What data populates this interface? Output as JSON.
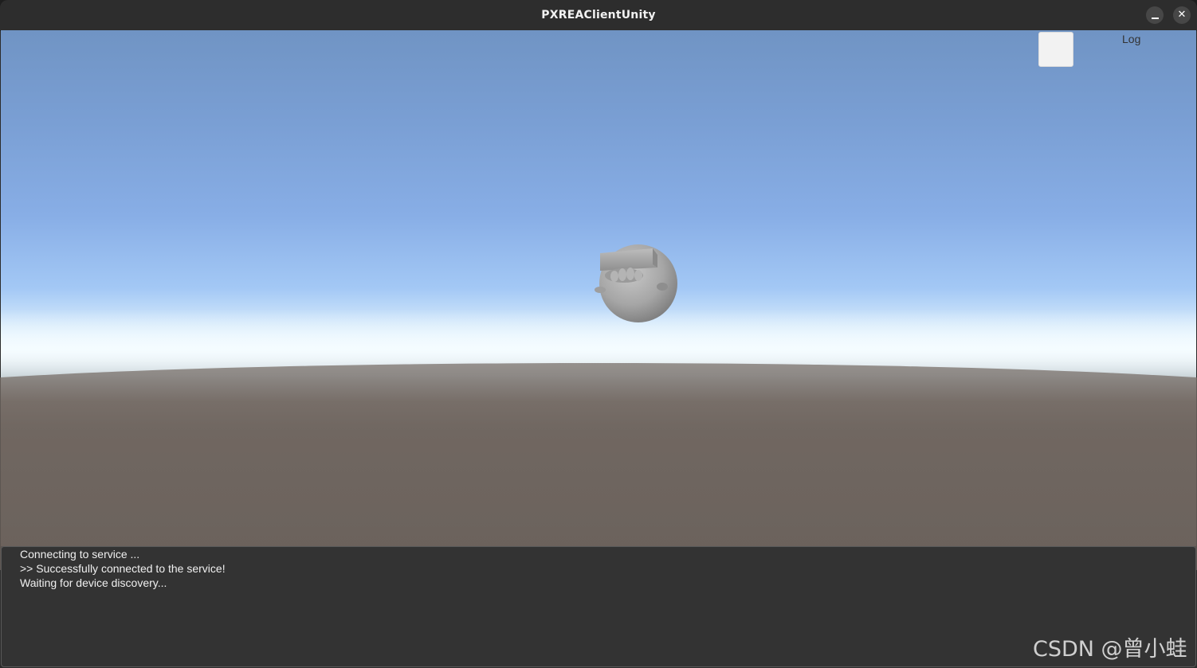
{
  "window": {
    "title": "PXREAClientUnity",
    "minimize_icon": "minimize-icon",
    "close_icon": "close-icon",
    "close_glyph": "✕"
  },
  "overlay": {
    "log_label": "Log"
  },
  "console": {
    "lines": [
      "Connecting to service ...",
      ">> Successfully connected to the service!",
      "Waiting for device discovery..."
    ]
  },
  "watermark": {
    "text": "CSDN @曾小蛙"
  },
  "colors": {
    "sky_top": "#7094c4",
    "horizon": "#f3fbff",
    "ground": "#6b625c",
    "console_bg": "#333333",
    "titlebar_bg": "#2d2d2d"
  }
}
